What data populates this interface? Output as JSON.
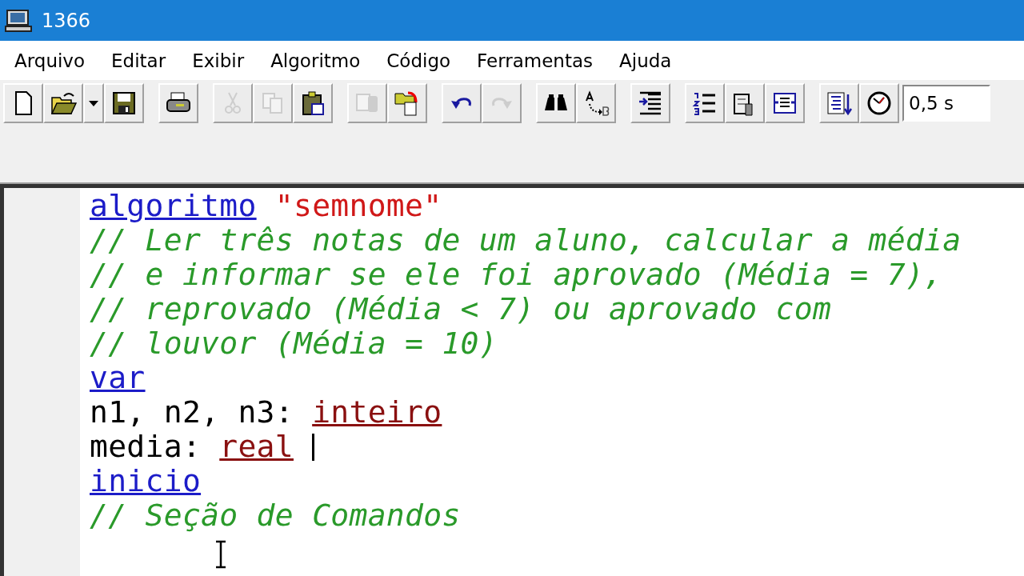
{
  "window": {
    "title": "1366"
  },
  "menu": [
    "Arquivo",
    "Editar",
    "Exibir",
    "Algoritmo",
    "Código",
    "Ferramentas",
    "Ajuda"
  ],
  "toolbar": [
    {
      "kind": "button",
      "disabled": false
    },
    {
      "kind": "button",
      "disabled": false
    },
    {
      "kind": "dropdown",
      "disabled": false
    },
    {
      "kind": "button",
      "disabled": false
    },
    {
      "kind": "gap"
    },
    {
      "kind": "button",
      "disabled": false
    },
    {
      "kind": "gap"
    },
    {
      "kind": "button",
      "disabled": true
    },
    {
      "kind": "button",
      "disabled": true
    },
    {
      "kind": "button",
      "disabled": false
    },
    {
      "kind": "gap"
    },
    {
      "kind": "button",
      "disabled": true
    },
    {
      "kind": "button",
      "disabled": false
    },
    {
      "kind": "gap"
    },
    {
      "kind": "button",
      "disabled": false
    },
    {
      "kind": "button",
      "disabled": true
    },
    {
      "kind": "gap"
    },
    {
      "kind": "button",
      "disabled": false
    },
    {
      "kind": "button",
      "disabled": false
    },
    {
      "kind": "gap"
    },
    {
      "kind": "button",
      "disabled": false
    },
    {
      "kind": "gap"
    },
    {
      "kind": "button",
      "disabled": false
    },
    {
      "kind": "button",
      "disabled": false
    },
    {
      "kind": "button",
      "disabled": false
    },
    {
      "kind": "gap"
    },
    {
      "kind": "button",
      "disabled": false
    },
    {
      "kind": "button",
      "disabled": false
    },
    {
      "kind": "field",
      "value": "0,5 s"
    }
  ],
  "code": [
    {
      "caret": false,
      "tokens": [
        {
          "kind": "keyword",
          "text": "algoritmo"
        },
        {
          "kind": "string",
          "text": " \"semnome\""
        }
      ]
    },
    {
      "caret": false,
      "tokens": [
        {
          "kind": "comment",
          "text": "// Ler três notas de um aluno, calcular a média"
        }
      ]
    },
    {
      "caret": false,
      "tokens": [
        {
          "kind": "comment",
          "text": "// e informar se ele foi aprovado (Média = 7),"
        }
      ]
    },
    {
      "caret": false,
      "tokens": [
        {
          "kind": "comment",
          "text": "// reprovado (Média < 7) ou aprovado com"
        }
      ]
    },
    {
      "caret": false,
      "tokens": [
        {
          "kind": "comment",
          "text": "// louvor (Média = 10)"
        }
      ]
    },
    {
      "caret": false,
      "tokens": [
        {
          "kind": "keyword",
          "text": "var"
        }
      ]
    },
    {
      "caret": false,
      "tokens": [
        {
          "kind": "plain",
          "text": "n1, n2, n3: "
        },
        {
          "kind": "type",
          "text": "inteiro"
        }
      ]
    },
    {
      "caret": true,
      "tokens": [
        {
          "kind": "plain",
          "text": "media: "
        },
        {
          "kind": "type",
          "text": "real"
        }
      ]
    },
    {
      "caret": false,
      "tokens": [
        {
          "kind": "keyword",
          "text": "inicio"
        }
      ]
    },
    {
      "caret": false,
      "tokens": [
        {
          "kind": "comment",
          "text": "// Seção de Comandos"
        }
      ]
    }
  ]
}
